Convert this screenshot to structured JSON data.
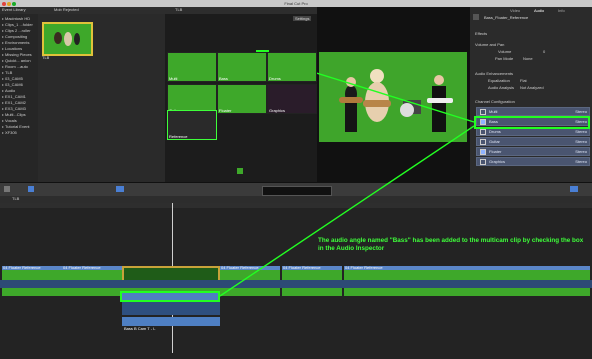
{
  "app": {
    "title": "Final Cut Pro"
  },
  "library": {
    "header": "Event Library",
    "items": [
      {
        "label": "Macintosh HD"
      },
      {
        "label": "Clips_1 ...folder"
      },
      {
        "label": "Clips 2 ...roller"
      },
      {
        "label": "Compositing"
      },
      {
        "label": "Environments"
      },
      {
        "label": "Locations"
      },
      {
        "label": "Missing Pieces"
      },
      {
        "label": "Quickt... anion"
      },
      {
        "label": "Room ...auto"
      },
      {
        "label": "TLB"
      },
      {
        "label": "03_CAM5"
      },
      {
        "label": "03_CAM6"
      },
      {
        "label": "Audio"
      },
      {
        "label": "EX1_CAM1"
      },
      {
        "label": "EX1_CAM2"
      },
      {
        "label": "EX3_CAM3"
      },
      {
        "label": "Multi...Clips"
      },
      {
        "label": "Vocals"
      },
      {
        "label": "Tutorial Event"
      },
      {
        "label": "XF305"
      }
    ]
  },
  "browser": {
    "header": "Mob Rejected",
    "clip_label": "TLB",
    "status": "1 of 1 selected, 1h:00:00"
  },
  "angle_viewer": {
    "header": "TLB",
    "settings_label": "Settings",
    "angles": [
      {
        "label": "Multi"
      },
      {
        "label": "Bass"
      },
      {
        "label": "Drums"
      },
      {
        "label": "Guitar"
      },
      {
        "label": "Floater"
      },
      {
        "label": "Graphics"
      },
      {
        "label": "Reference"
      }
    ]
  },
  "inspector": {
    "tabs": [
      "Video",
      "Audio",
      "Info"
    ],
    "clip_name": "Bass_Floater_Reference",
    "effects_label": "Effects",
    "volume_pan_label": "Volume and Pan",
    "volume_label": "Volume",
    "volume_value": "0",
    "pan_mode_label": "Pan Mode",
    "pan_mode_value": "None",
    "enhancements_label": "Audio Enhancements",
    "equalization_label": "Equalization",
    "equalization_value": "Flat",
    "analysis_label": "Audio Analysis",
    "analysis_value": "Not Analyzed",
    "channel_config_label": "Channel Configuration",
    "channels": [
      {
        "label": "Multi",
        "value": "Stereo",
        "checked": false
      },
      {
        "label": "Bass",
        "value": "Stereo",
        "checked": true
      },
      {
        "label": "Drums",
        "value": "Stereo",
        "checked": false
      },
      {
        "label": "Guitar",
        "value": "Stereo",
        "checked": false
      },
      {
        "label": "Floater",
        "value": "Stereo",
        "checked": true
      },
      {
        "label": "Graphics",
        "value": "Stereo",
        "checked": false
      }
    ]
  },
  "timeline": {
    "header": "TLB",
    "annotation": "The audio angle named \"Bass\" has been added to the multicam clip by checking the box in the Audio Inspector",
    "clip_labels": [
      "04 Floater Reference",
      "04 Floater Reference",
      "09 Multi Floater Reference",
      "04 Floater Reference",
      "04 Floater Reference",
      "04 Floater Reference"
    ],
    "audio_labels": [
      "Multi - VAN_1_T2 - L",
      "Bass B Cam T - L"
    ]
  },
  "colors": {
    "accent_green": "#22ff22",
    "clip_green": "#3ea82a",
    "audio_blue": "#4e7fc3"
  }
}
